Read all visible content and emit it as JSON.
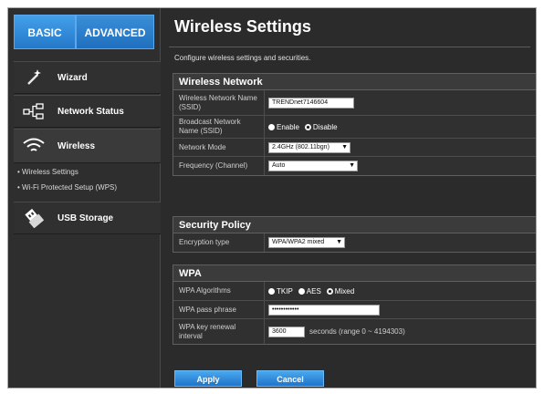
{
  "tabs": {
    "basic": "BASIC",
    "advanced": "ADVANCED"
  },
  "nav": {
    "wizard": "Wizard",
    "network_status": "Network Status",
    "wireless": "Wireless",
    "wireless_sub": [
      "Wireless Settings",
      "Wi-Fi Protected Setup (WPS)"
    ],
    "usb_storage": "USB Storage"
  },
  "page": {
    "title": "Wireless Settings",
    "description": "Configure wireless settings and securities."
  },
  "wireless_network": {
    "heading": "Wireless Network",
    "ssid_label": "Wireless Network Name (SSID)",
    "ssid_value": "TRENDnet7146604",
    "broadcast_label": "Broadcast Network Name (SSID)",
    "broadcast_options": [
      "Enable",
      "Disable"
    ],
    "broadcast_selected": "Disable",
    "mode_label": "Network Mode",
    "mode_value": "2.4GHz (802.11bgn)",
    "frequency_label": "Frequency (Channel)",
    "frequency_value": "Auto"
  },
  "security_policy": {
    "heading": "Security Policy",
    "encryption_label": "Encryption type",
    "encryption_value": "WPA/WPA2 mixed"
  },
  "wpa": {
    "heading": "WPA",
    "algorithms_label": "WPA Algorithms",
    "algorithms_options": [
      "TKIP",
      "AES",
      "Mixed"
    ],
    "algorithms_selected": "Mixed",
    "passphrase_label": "WPA pass phrase",
    "passphrase_value": "••••••••••••",
    "renewal_label": "WPA key renewal interval",
    "renewal_value": "3600",
    "renewal_suffix": "seconds (range 0 ~ 4194303)"
  },
  "buttons": {
    "apply": "Apply",
    "cancel": "Cancel"
  },
  "colors": {
    "accent": "#2479c9",
    "background": "#2b2b2b",
    "panel": "#303030"
  }
}
